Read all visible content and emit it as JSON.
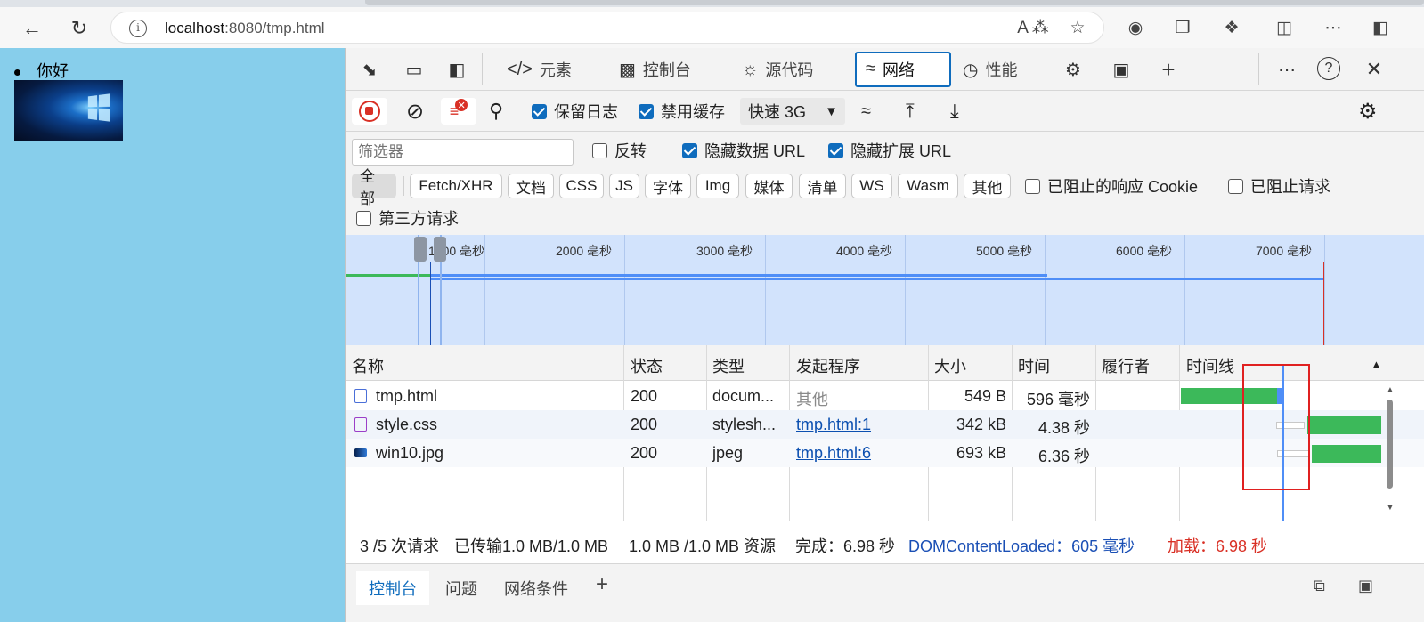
{
  "browser": {
    "url_host": "localhost",
    "url_rest": ":8080/tmp.html",
    "info_glyph": "i",
    "icons": [
      "back-icon",
      "refresh-icon",
      "read-aloud-icon",
      "favorite-icon",
      "extension-icon",
      "collections-icon",
      "puzzle-icon",
      "split-screen-icon",
      "more-icon",
      "sidebar-icon"
    ]
  },
  "page": {
    "list_item": "你好"
  },
  "devtools": {
    "tabs": [
      {
        "label": "元素"
      },
      {
        "label": "控制台"
      },
      {
        "label": "源代码"
      },
      {
        "label": "网络"
      },
      {
        "label": "性能"
      }
    ],
    "toolbar": {
      "preserve_log": "保留日志",
      "disable_cache": "禁用缓存",
      "throttling": "快速 3G"
    },
    "filter": {
      "placeholder": "筛选器",
      "invert": "反转",
      "hide_data_url": "隐藏数据 URL",
      "hide_ext_url": "隐藏扩展 URL",
      "types": [
        "全部",
        "Fetch/XHR",
        "文档",
        "CSS",
        "JS",
        "字体",
        "Img",
        "媒体",
        "清单",
        "WS",
        "Wasm",
        "其他"
      ],
      "blocked_cookies": "已阻止的响应 Cookie",
      "blocked_requests": "已阻止请求",
      "third_party": "第三方请求"
    },
    "overview_ticks": [
      "1000 毫秒",
      "2000 毫秒",
      "3000 毫秒",
      "4000 毫秒",
      "5000 毫秒",
      "6000 毫秒",
      "7000 毫秒"
    ],
    "columns": [
      "名称",
      "状态",
      "类型",
      "发起程序",
      "大小",
      "时间",
      "履行者",
      "时间线"
    ],
    "rows": [
      {
        "name": "tmp.html",
        "status": "200",
        "type": "docum...",
        "initiator": "其他",
        "size": "549 B",
        "time": "596 毫秒"
      },
      {
        "name": "style.css",
        "status": "200",
        "type": "stylesh...",
        "initiator": "tmp.html:1",
        "size": "342 kB",
        "time": "4.38 秒"
      },
      {
        "name": "win10.jpg",
        "status": "200",
        "type": "jpeg",
        "initiator": "tmp.html:6",
        "size": "693 kB",
        "time": "6.36 秒"
      }
    ],
    "status": {
      "requests": "3 /5 次请求",
      "transferred": "已传输1.0 MB/1.0 MB",
      "resources": "1.0 MB /1.0 MB 资源",
      "finish": "完成：6.98 秒",
      "dcl": "DOMContentLoaded：605 毫秒",
      "load": "加载：6.98 秒"
    },
    "drawer_tabs": [
      "控制台",
      "问题",
      "网络条件"
    ],
    "colors": {
      "accent": "#0f6cbd",
      "dcl": "#1a4fb5",
      "load": "#d93025",
      "bar_green": "#3cb95a",
      "highlight_box": "#e02020"
    }
  }
}
